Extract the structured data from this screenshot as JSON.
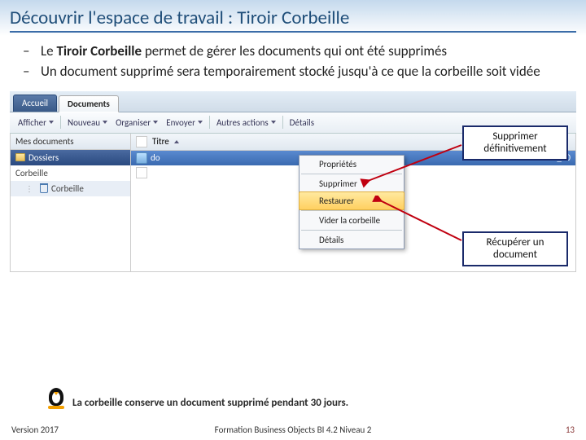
{
  "header": {
    "title": "Découvrir l'espace de travail : Tiroir Corbeille"
  },
  "bullets": {
    "b1_pre": "Le ",
    "b1_bold": "Tiroir Corbeille",
    "b1_post": " permet de gérer les documents qui ont été supprimés",
    "b2": "Un document supprimé sera temporairement stocké jusqu'à ce que la corbeille soit vidée"
  },
  "tabs": {
    "home": "Accueil",
    "docs": "Documents"
  },
  "toolbar": {
    "afficher": "Afficher",
    "nouveau": "Nouveau",
    "organiser": "Organiser",
    "envoyer": "Envoyer",
    "autres": "Autres actions",
    "details": "Détails"
  },
  "nav": {
    "mydocs": "Mes documents",
    "folders": "Dossiers",
    "corbeille_hdr": "Corbeille",
    "corbeille": "Corbeille"
  },
  "content": {
    "col_title": "Titre",
    "row_prefix": "do",
    "row_suffix": "ument_30"
  },
  "ctx": {
    "props": "Propriétés",
    "del": "Supprimer",
    "restore": "Restaurer",
    "empty": "Vider la corbeille",
    "details": "Détails"
  },
  "callouts": {
    "c1a": "Supprimer",
    "c1b": "définitivement",
    "c2a": "Récupérer un",
    "c2b": "document"
  },
  "note": "La corbeille conserve un document supprimé pendant 30 jours.",
  "footer": {
    "version": "Version 2017",
    "center": "Formation Business Objects BI 4.2 Niveau 2",
    "page": "13"
  }
}
